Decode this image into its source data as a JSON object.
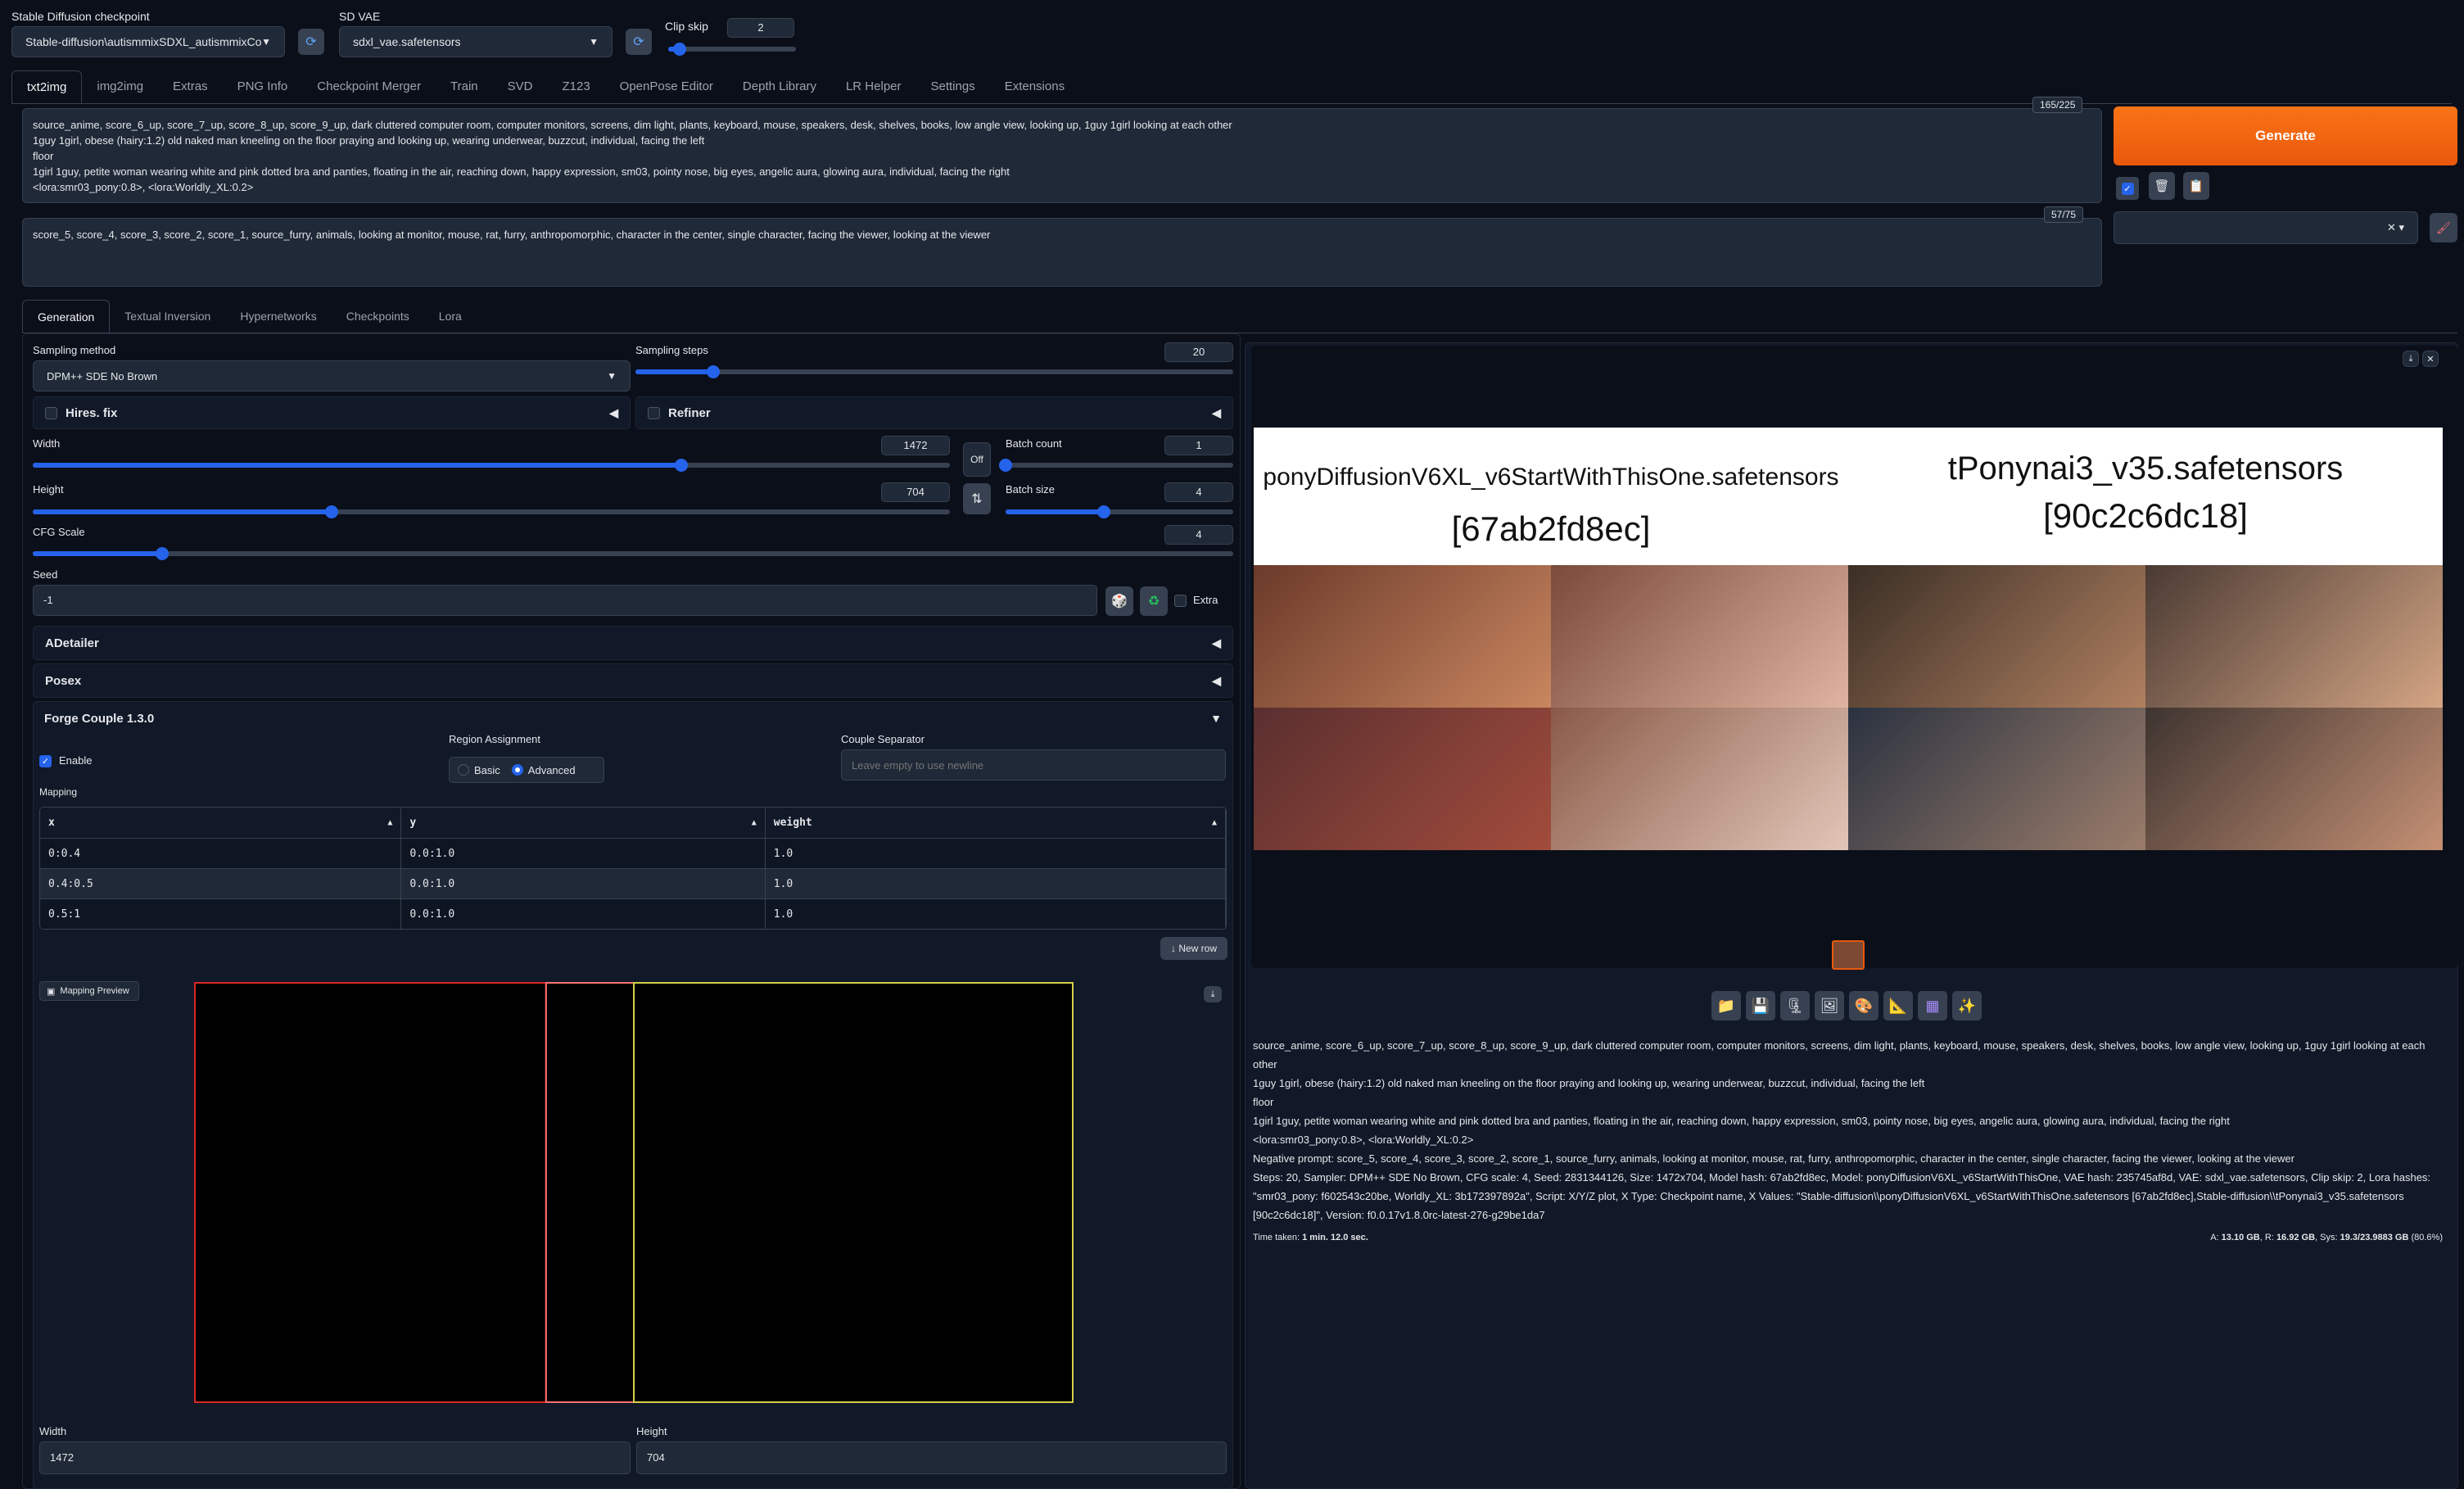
{
  "top": {
    "checkpoint_label": "Stable Diffusion checkpoint",
    "checkpoint_value": "Stable-diffusion\\autismmixSDXL_autismmixCo",
    "vae_label": "SD VAE",
    "vae_value": "sdxl_vae.safetensors",
    "clipskip_label": "Clip skip",
    "clipskip_value": "2"
  },
  "main_tabs": [
    "txt2img",
    "img2img",
    "Extras",
    "PNG Info",
    "Checkpoint Merger",
    "Train",
    "SVD",
    "Z123",
    "OpenPose Editor",
    "Depth Library",
    "LR Helper",
    "Settings",
    "Extensions"
  ],
  "prompt": {
    "text": "source_anime, score_6_up, score_7_up, score_8_up, score_9_up, dark cluttered computer room, computer monitors, screens, dim light, plants, keyboard, mouse, speakers, desk, shelves, books, low angle view, looking up, 1guy 1girl looking at each other\n1guy 1girl, obese (hairy:1.2) old naked man kneeling on the floor praying and looking up, wearing underwear, buzzcut, individual, facing the left\nfloor\n1girl 1guy, petite woman wearing white and pink dotted bra and panties, floating in the air, reaching down, happy expression, sm03, pointy nose, big eyes, angelic aura, glowing aura, individual, facing the right\n<lora:smr03_pony:0.8>, <lora:Worldly_XL:0.2>",
    "counter": "165/225",
    "neg_text": "score_5, score_4, score_3, score_2, score_1, source_furry, animals, looking at monitor, mouse, rat, furry, anthropomorphic, character in the center, single character, facing the viewer, looking at the viewer",
    "neg_counter": "57/75"
  },
  "generate_label": "Generate",
  "sub_tabs": [
    "Generation",
    "Textual Inversion",
    "Hypernetworks",
    "Checkpoints",
    "Lora"
  ],
  "gen": {
    "sampling_method_label": "Sampling method",
    "sampling_method": "DPM++ SDE No Brown",
    "sampling_steps_label": "Sampling steps",
    "sampling_steps": "20",
    "steps_fraction": 0.13,
    "hires_label": "Hires. fix",
    "refiner_label": "Refiner",
    "width_label": "Width",
    "width": "1472",
    "width_fraction": 0.707,
    "height_label": "Height",
    "height": "704",
    "height_fraction": 0.326,
    "off_label": "Off",
    "batch_count_label": "Batch count",
    "batch_count": "1",
    "batch_count_fraction": 0.0,
    "batch_size_label": "Batch size",
    "batch_size": "4",
    "batch_size_fraction": 0.43,
    "cfg_label": "CFG Scale",
    "cfg": "4",
    "cfg_fraction": 0.108,
    "seed_label": "Seed",
    "seed": "-1",
    "extra_label": "Extra",
    "adetailer": "ADetailer",
    "posex": "Posex",
    "forge_couple": "Forge Couple 1.3.0",
    "enable_label": "Enable",
    "region_assignment_label": "Region Assignment",
    "basic_label": "Basic",
    "advanced_label": "Advanced",
    "couple_sep_label": "Couple Separator",
    "couple_sep_placeholder": "Leave empty to use newline",
    "mapping_label": "Mapping",
    "mapping_cols": [
      "x",
      "y",
      "weight"
    ],
    "mapping_rows": [
      [
        "0:0.4",
        "0.0:1.0",
        "1.0"
      ],
      [
        "0.4:0.5",
        "0.0:1.0",
        "1.0"
      ],
      [
        "0.5:1",
        "0.0:1.0",
        "1.0"
      ]
    ],
    "new_row_label": "New row",
    "mapping_preview_label": "Mapping Preview",
    "preview_width_label": "Width",
    "preview_width": "1472",
    "preview_height_label": "Height",
    "preview_height": "704"
  },
  "output": {
    "grid_col1_title": "ponyDiffusionV6XL_v6StartWithThisOne.safetensors",
    "grid_col1_hash": "[67ab2fd8ec]",
    "grid_col2_title": "tPonynai3_v35.safetensors",
    "grid_col2_hash": "[90c2c6dc18]",
    "info_lines": [
      "source_anime, score_6_up, score_7_up, score_8_up, score_9_up, dark cluttered computer room, computer monitors, screens, dim light, plants, keyboard, mouse, speakers, desk, shelves, books, low angle view, looking up, 1guy 1girl looking at each",
      "other",
      "1guy 1girl, obese (hairy:1.2) old naked man kneeling on the floor praying and looking up, wearing underwear, buzzcut, individual, facing the left",
      "floor",
      "1girl 1guy, petite woman wearing white and pink dotted bra and panties, floating in the air, reaching down, happy expression, sm03, pointy nose, big eyes, angelic aura, glowing aura, individual, facing the right",
      "<lora:smr03_pony:0.8>, <lora:Worldly_XL:0.2>",
      "Negative prompt: score_5, score_4, score_3, score_2, score_1, source_furry, animals, looking at monitor, mouse, rat, furry, anthropomorphic, character in the center, single character, facing the viewer, looking at the viewer",
      "Steps: 20, Sampler: DPM++ SDE No Brown, CFG scale: 4, Seed: 2831344126, Size: 1472x704, Model hash: 67ab2fd8ec, Model: ponyDiffusionV6XL_v6StartWithThisOne, VAE hash: 235745af8d, VAE: sdxl_vae.safetensors, Clip skip: 2, Lora hashes:",
      "\"smr03_pony: f602543c20be, Worldly_XL: 3b172397892a\", Script: X/Y/Z plot, X Type: Checkpoint name, X Values: \"Stable-diffusion\\\\ponyDiffusionV6XL_v6StartWithThisOne.safetensors [67ab2fd8ec],Stable-diffusion\\\\tPonynai3_v35.safetensors",
      "[90c2c6dc18]\", Version: f0.0.17v1.8.0rc-latest-276-g29be1da7"
    ],
    "time_label": "Time taken:",
    "time_value": "1 min. 12.0 sec.",
    "vram_prefix_a": "A:",
    "vram_a": "13.10 GB",
    "vram_prefix_r": ", R:",
    "vram_r": "16.92 GB",
    "vram_prefix_sys": ", Sys:",
    "vram_sys": "19.3/23.9883 GB",
    "vram_pct": "(80.6%)"
  },
  "colors": {
    "accent": "#2563eb",
    "generate": "#ea580c",
    "region1": "#dc2626",
    "region2": "#f87171",
    "region3": "#d4d048"
  }
}
